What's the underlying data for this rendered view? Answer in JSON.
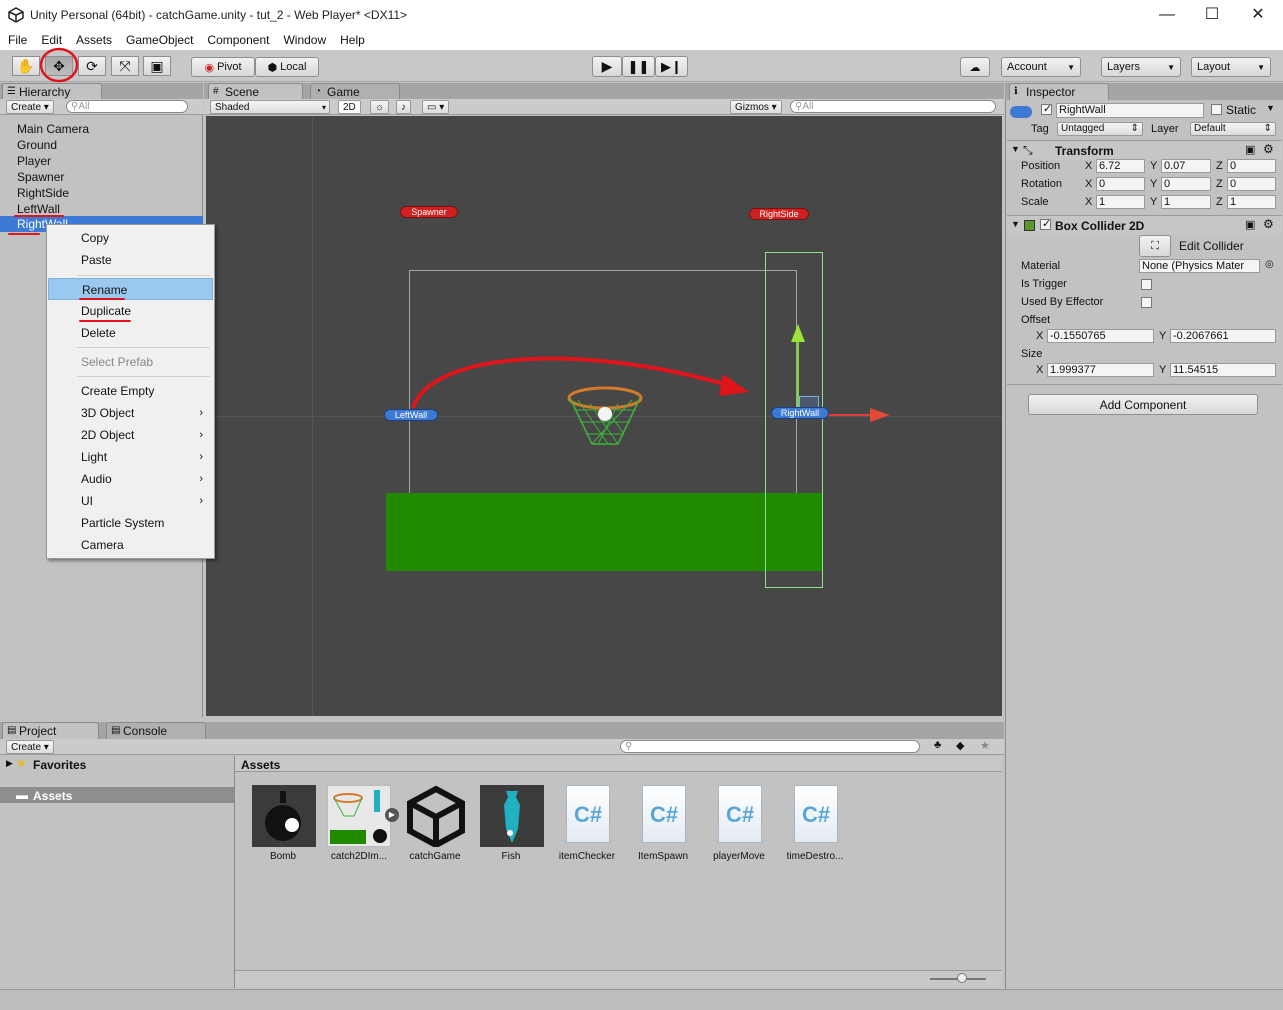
{
  "window": {
    "title": "Unity Personal (64bit) - catchGame.unity - tut_2 - Web Player* <DX11>",
    "min": "—",
    "max": "☐",
    "close": "✕"
  },
  "menu": [
    "File",
    "Edit",
    "Assets",
    "GameObject",
    "Component",
    "Window",
    "Help"
  ],
  "toolbar": {
    "pivot": "Pivot",
    "local": "Local",
    "account": "Account",
    "layers": "Layers",
    "layout": "Layout"
  },
  "hierarchy": {
    "tab": "Hierarchy",
    "create": "Create",
    "search_placeholder": "All",
    "items": [
      "Main Camera",
      "Ground",
      "Player",
      "Spawner",
      "RightSide",
      "LeftWall",
      "RightWall"
    ]
  },
  "context_menu": {
    "copy": "Copy",
    "paste": "Paste",
    "rename": "Rename",
    "duplicate": "Duplicate",
    "delete": "Delete",
    "select_prefab": "Select Prefab",
    "create_empty": "Create Empty",
    "object_3d": "3D Object",
    "object_2d": "2D Object",
    "light": "Light",
    "audio": "Audio",
    "ui": "UI",
    "particle": "Particle System",
    "camera": "Camera"
  },
  "scene": {
    "tab_scene": "Scene",
    "tab_game": "Game",
    "shaded": "Shaded",
    "mode_2d": "2D",
    "gizmos": "Gizmos",
    "search_placeholder": "All",
    "labels": {
      "spawner": "Spawner",
      "rightside": "RightSide",
      "leftwall": "LeftWall",
      "rightwall": "RightWall"
    }
  },
  "inspector": {
    "tab": "Inspector",
    "name": "RightWall",
    "static": "Static",
    "tag_label": "Tag",
    "tag": "Untagged",
    "layer_label": "Layer",
    "layer": "Default",
    "transform": {
      "title": "Transform",
      "position_label": "Position",
      "rotation_label": "Rotation",
      "scale_label": "Scale",
      "position": {
        "x": "6.72",
        "y": "0.07",
        "z": "0"
      },
      "rotation": {
        "x": "0",
        "y": "0",
        "z": "0"
      },
      "scale": {
        "x": "1",
        "y": "1",
        "z": "1"
      }
    },
    "collider": {
      "title": "Box Collider 2D",
      "edit": "Edit Collider",
      "material_label": "Material",
      "material": "None (Physics Mater",
      "trigger_label": "Is Trigger",
      "effector_label": "Used By Effector",
      "offset_label": "Offset",
      "offset": {
        "x": "-0.1550765",
        "y": "-0.2067661"
      },
      "size_label": "Size",
      "size": {
        "x": "1.999377",
        "y": "11.54515"
      }
    },
    "add_component": "Add Component"
  },
  "project": {
    "tab_project": "Project",
    "tab_console": "Console",
    "create": "Create",
    "favorites": "Favorites",
    "assets_folder": "Assets",
    "assets_header": "Assets",
    "assets": [
      "Bomb",
      "catch2DIm...",
      "catchGame",
      "Fish",
      "itemChecker",
      "ItemSpawn",
      "playerMove",
      "timeDestro..."
    ]
  },
  "axis": {
    "x": "X",
    "y": "Y",
    "z": "Z"
  },
  "colors": {
    "annotation": "#e0141b",
    "selection": "#3d7ad6",
    "ground": "#1f8a00"
  }
}
